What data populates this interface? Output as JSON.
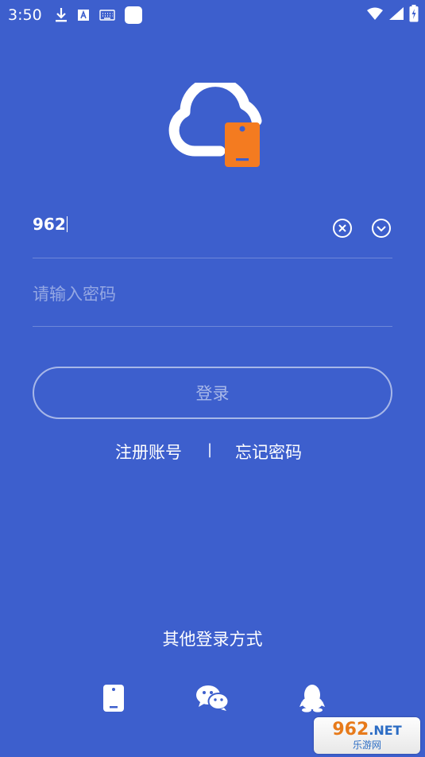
{
  "status_bar": {
    "time": "3:50",
    "icons": [
      "download-icon",
      "text-a-icon",
      "keyboard-icon",
      "app-square-icon",
      "wifi-icon",
      "signal-icon",
      "battery-icon"
    ]
  },
  "login": {
    "account_value": "962",
    "password_placeholder": "请输入密码",
    "login_label": "登录"
  },
  "links": {
    "register": "注册账号",
    "separator": "|",
    "forgot": "忘记密码"
  },
  "other_login": {
    "title": "其他登录方式",
    "methods": [
      "phone-icon",
      "wechat-icon",
      "qq-icon"
    ]
  },
  "watermark": {
    "top_num": "962",
    "top_net": ".NET",
    "bottom": "乐游网"
  },
  "colors": {
    "background": "#3d5fcd",
    "logo_accent": "#f47b20",
    "text": "#ffffff"
  }
}
